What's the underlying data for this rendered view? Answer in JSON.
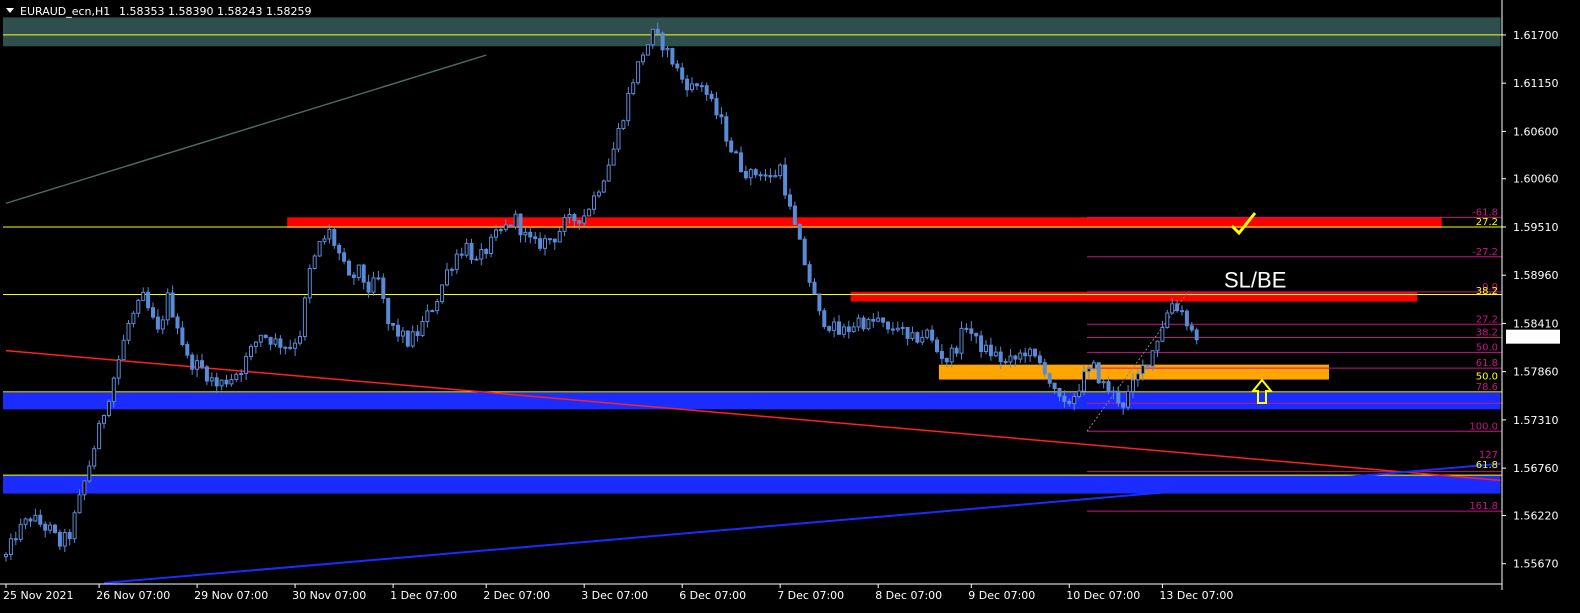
{
  "header": {
    "symbol": "EURAUD_ecn,H1",
    "ohlc": "1.58353 1.58390 1.58243 1.58259"
  },
  "colors": {
    "background": "#000000",
    "axis": "#ffffff",
    "bull_candle": "#5b8bd6",
    "bear_candle": "#5b8bd6",
    "resistance_zone": "#ff0000",
    "support_zone": "#1a2cff",
    "entry_zone": "#ffa500",
    "top_zone": "#2f4f4f",
    "horizontal_line": "#ffff00",
    "fib_line": "#c71585",
    "fib_text": "#c71585",
    "fib_text_yellow": "#ffff00",
    "red_trendline": "#ff2020",
    "blue_trendline": "#1a2cff",
    "annotation": "#ffff00",
    "price_tag_bg": "#ffffff",
    "price_tag_text": "#000000"
  },
  "annotations": {
    "sl_be": "SL/BE",
    "check_icon": "check-mark",
    "arrow_icon": "up-arrow"
  },
  "chart_data": {
    "type": "candlestick",
    "symbol": "EURAUD_ecn",
    "timeframe": "H1",
    "y_range": [
      1.5545,
      1.6195
    ],
    "y_ticks": [
      "1.61700",
      "1.61150",
      "1.60600",
      "1.60060",
      "1.59510",
      "1.58960",
      "1.58410",
      "1.57860",
      "1.57310",
      "1.56760",
      "1.56220",
      "1.55670"
    ],
    "x_ticks": [
      "25 Nov 2021",
      "26 Nov 07:00",
      "29 Nov 07:00",
      "30 Nov 07:00",
      "1 Dec 07:00",
      "2 Dec 07:00",
      "3 Dec 07:00",
      "6 Dec 07:00",
      "7 Dec 07:00",
      "8 Dec 07:00",
      "9 Dec 07:00",
      "10 Dec 07:00",
      "13 Dec 07:00"
    ],
    "current_price": "1.58259",
    "close_path": [
      [
        0,
        1.5575
      ],
      [
        2,
        1.56
      ],
      [
        5,
        1.562
      ],
      [
        9,
        1.5605
      ],
      [
        11,
        1.559
      ],
      [
        13,
        1.56
      ],
      [
        16,
        1.566
      ],
      [
        19,
        1.572
      ],
      [
        22,
        1.578
      ],
      [
        25,
        1.584
      ],
      [
        28,
        1.587
      ],
      [
        31,
        1.583
      ],
      [
        33,
        1.587
      ],
      [
        35,
        1.584
      ],
      [
        37,
        1.58
      ],
      [
        40,
        1.579
      ],
      [
        43,
        1.577
      ],
      [
        46,
        1.578
      ],
      [
        48,
        1.579
      ],
      [
        50,
        1.581
      ],
      [
        52,
        1.583
      ],
      [
        55,
        1.582
      ],
      [
        58,
        1.5815
      ],
      [
        60,
        1.583
      ],
      [
        62,
        1.59
      ],
      [
        64,
        1.593
      ],
      [
        66,
        1.5945
      ],
      [
        68,
        1.592
      ],
      [
        70,
        1.589
      ],
      [
        72,
        1.59
      ],
      [
        74,
        1.588
      ],
      [
        76,
        1.589
      ],
      [
        78,
        1.584
      ],
      [
        80,
        1.583
      ],
      [
        82,
        1.582
      ],
      [
        84,
        1.583
      ],
      [
        86,
        1.585
      ],
      [
        88,
        1.587
      ],
      [
        90,
        1.59
      ],
      [
        92,
        1.592
      ],
      [
        94,
        1.593
      ],
      [
        96,
        1.591
      ],
      [
        98,
        1.5925
      ],
      [
        100,
        1.594
      ],
      [
        102,
        1.595
      ],
      [
        104,
        1.596
      ],
      [
        106,
        1.594
      ],
      [
        108,
        1.593
      ],
      [
        110,
        1.5935
      ],
      [
        112,
        1.594
      ],
      [
        114,
        1.5955
      ],
      [
        116,
        1.596
      ],
      [
        118,
        1.5965
      ],
      [
        120,
        1.5985
      ],
      [
        122,
        1.601
      ],
      [
        124,
        1.604
      ],
      [
        126,
        1.608
      ],
      [
        128,
        1.612
      ],
      [
        130,
        1.615
      ],
      [
        132,
        1.617
      ],
      [
        134,
        1.616
      ],
      [
        136,
        1.614
      ],
      [
        138,
        1.612
      ],
      [
        140,
        1.611
      ],
      [
        142,
        1.6115
      ],
      [
        144,
        1.609
      ],
      [
        146,
        1.607
      ],
      [
        148,
        1.604
      ],
      [
        150,
        1.602
      ],
      [
        152,
        1.601
      ],
      [
        154,
        1.6015
      ],
      [
        156,
        1.6005
      ],
      [
        158,
        1.602
      ],
      [
        160,
        1.597
      ],
      [
        162,
        1.593
      ],
      [
        164,
        1.589
      ],
      [
        166,
        1.585
      ],
      [
        168,
        1.584
      ],
      [
        170,
        1.583
      ],
      [
        172,
        1.5835
      ],
      [
        174,
        1.5845
      ],
      [
        176,
        1.584
      ],
      [
        178,
        1.5845
      ],
      [
        180,
        1.583
      ],
      [
        182,
        1.584
      ],
      [
        184,
        1.582
      ],
      [
        186,
        1.5825
      ],
      [
        188,
        1.583
      ],
      [
        190,
        1.581
      ],
      [
        192,
        1.58
      ],
      [
        194,
        1.5815
      ],
      [
        196,
        1.584
      ],
      [
        198,
        1.582
      ],
      [
        200,
        1.581
      ],
      [
        202,
        1.5805
      ],
      [
        204,
        1.5795
      ],
      [
        206,
        1.58
      ],
      [
        208,
        1.581
      ],
      [
        210,
        1.58
      ],
      [
        212,
        1.579
      ],
      [
        214,
        1.576
      ],
      [
        216,
        1.5745
      ],
      [
        218,
        1.576
      ],
      [
        220,
        1.578
      ],
      [
        222,
        1.579
      ],
      [
        224,
        1.577
      ],
      [
        226,
        1.576
      ],
      [
        228,
        1.575
      ],
      [
        230,
        1.577
      ],
      [
        232,
        1.579
      ],
      [
        234,
        1.581
      ],
      [
        236,
        1.584
      ],
      [
        238,
        1.5865
      ],
      [
        240,
        1.5855
      ],
      [
        242,
        1.5832
      ],
      [
        243,
        1.5826
      ]
    ],
    "bar_count": 244,
    "x_tick_bars": [
      0,
      19,
      39,
      59,
      79,
      98,
      118,
      138,
      158,
      178,
      197,
      217,
      236
    ],
    "horizontal_lines": [
      1.617,
      1.5951,
      1.5874,
      1.5763,
      1.5668
    ],
    "zones": [
      {
        "name": "top-zone",
        "from_bar": 0,
        "to_bar": 305,
        "y1": 1.619,
        "y2": 1.6157,
        "color_key": "top_zone"
      },
      {
        "name": "resistance-zone-upper",
        "from_bar": 58,
        "to_bar": 293,
        "y1": 1.5962,
        "y2": 1.595,
        "color_key": "resistance_zone"
      },
      {
        "name": "resistance-zone-lower",
        "from_bar": 173,
        "to_bar": 288,
        "y1": 1.5877,
        "y2": 1.5866,
        "color_key": "resistance_zone"
      },
      {
        "name": "entry-zone",
        "from_bar": 191,
        "to_bar": 270,
        "y1": 1.5794,
        "y2": 1.5777,
        "color_key": "entry_zone"
      },
      {
        "name": "support-zone-upper",
        "from_bar": 0,
        "to_bar": 305,
        "y1": 1.5762,
        "y2": 1.5743,
        "color_key": "support_zone"
      },
      {
        "name": "support-zone-lower",
        "from_bar": 0,
        "to_bar": 305,
        "y1": 1.5668,
        "y2": 1.5647,
        "color_key": "support_zone"
      }
    ],
    "trendlines": [
      {
        "name": "grey-trendline",
        "p1": [
          0,
          1.5978
        ],
        "p2": [
          98,
          1.6147
        ],
        "color": "#4a6a5a"
      },
      {
        "name": "red-trendline",
        "p1": [
          0,
          1.581
        ],
        "p2": [
          305,
          1.5662
        ],
        "color_key": "red_trendline"
      },
      {
        "name": "blue-trendline",
        "p1": [
          20,
          1.5545
        ],
        "p2": [
          305,
          1.5681
        ],
        "color_key": "blue_trendline"
      }
    ],
    "fib_levels": [
      {
        "label": "-61.8",
        "price": 1.5962,
        "color_key": "fib_text"
      },
      {
        "label": "27.2",
        "price": 1.5951,
        "color_key": "fib_text_yellow"
      },
      {
        "label": "-27.2",
        "price": 1.5917,
        "color_key": "fib_text"
      },
      {
        "label": "0.0",
        "price": 1.5877,
        "color_key": "fib_text"
      },
      {
        "label": "38.2",
        "price": 1.5872,
        "color_key": "fib_text_yellow"
      },
      {
        "label": "27.2",
        "price": 1.584,
        "color_key": "fib_text"
      },
      {
        "label": "38.2",
        "price": 1.5825,
        "color_key": "fib_text"
      },
      {
        "label": "50.0",
        "price": 1.5808,
        "color_key": "fib_text"
      },
      {
        "label": "61.8",
        "price": 1.579,
        "color_key": "fib_text"
      },
      {
        "label": "50.0",
        "price": 1.5775,
        "color_key": "fib_text_yellow"
      },
      {
        "label": "78.6",
        "price": 1.5763,
        "color_key": "fib_text"
      },
      {
        "label": "100.0",
        "price": 1.5718,
        "color_key": "fib_text"
      },
      {
        "label": "127",
        "price": 1.5685,
        "color_key": "fib_text"
      },
      {
        "label": "61.8",
        "price": 1.5674,
        "color_key": "fib_text_yellow"
      },
      {
        "label": "161.8",
        "price": 1.5627,
        "color_key": "fib_text"
      }
    ],
    "fib_lines": [
      1.5962,
      1.5917,
      1.5877,
      1.584,
      1.5825,
      1.5808,
      1.579,
      1.575,
      1.5718,
      1.5672,
      1.5627
    ]
  }
}
